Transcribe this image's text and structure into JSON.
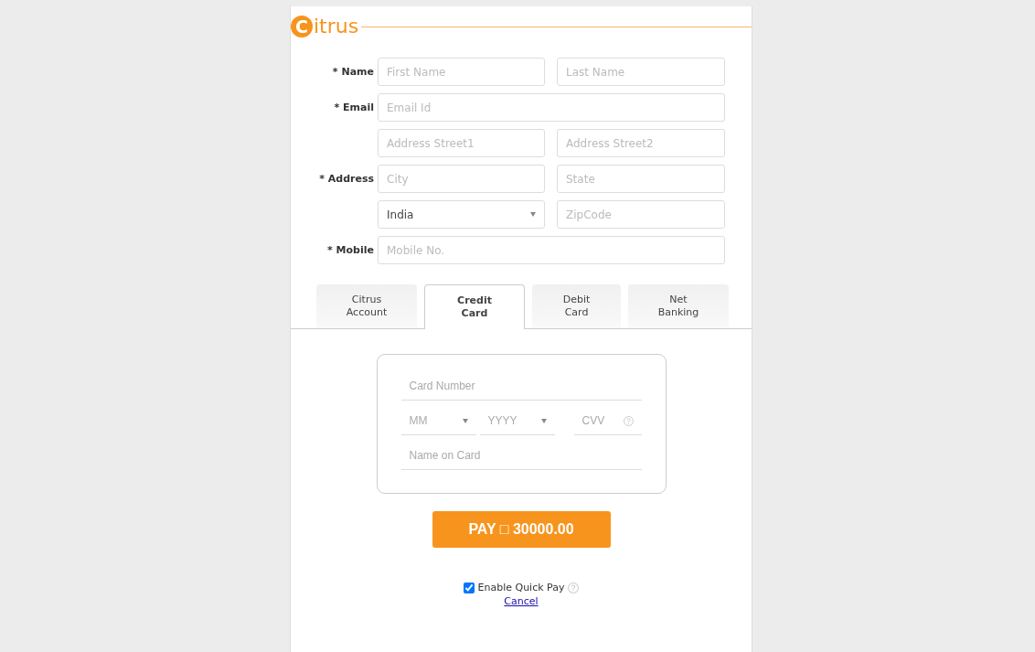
{
  "logo": "Citrus",
  "form": [
    {
      "label": "* Name",
      "fields": [
        {
          "kind": "input",
          "placeholder": "First Name"
        },
        {
          "kind": "input",
          "placeholder": "Last Name"
        }
      ]
    },
    {
      "label": "* Email",
      "fields": [
        {
          "kind": "input",
          "placeholder": "Email Id"
        }
      ]
    },
    {
      "fields": [
        {
          "kind": "input",
          "placeholder": "Address Street1"
        },
        {
          "kind": "input",
          "placeholder": "Address Street2"
        }
      ]
    },
    {
      "label": "* Address",
      "fields": [
        {
          "kind": "input",
          "placeholder": "City"
        },
        {
          "kind": "input",
          "placeholder": "State"
        }
      ]
    },
    {
      "fields": [
        {
          "kind": "select",
          "value": "India"
        },
        {
          "kind": "input",
          "placeholder": "ZipCode"
        }
      ]
    },
    {
      "label": "* Mobile",
      "fields": [
        {
          "kind": "input",
          "placeholder": "Mobile No."
        }
      ]
    }
  ],
  "tabs": [
    {
      "label": "Citrus\nAccount",
      "selected": false
    },
    {
      "label": "Credit\nCard",
      "selected": true
    },
    {
      "label": "Debit\nCard",
      "selected": false
    },
    {
      "label": "Net\nBanking",
      "selected": false
    }
  ],
  "card": {
    "number": {
      "placeholder": "Card Number"
    },
    "month": {
      "value": "MM"
    },
    "year": {
      "value": "YYYY"
    },
    "cvv": {
      "placeholder": "CVV"
    },
    "name": {
      "placeholder": "Name on Card"
    }
  },
  "pay_button": "PAY □ 30000.00",
  "quick_pay": {
    "label": "Enable Quick Pay",
    "checked": true
  },
  "cancel": "Cancel"
}
